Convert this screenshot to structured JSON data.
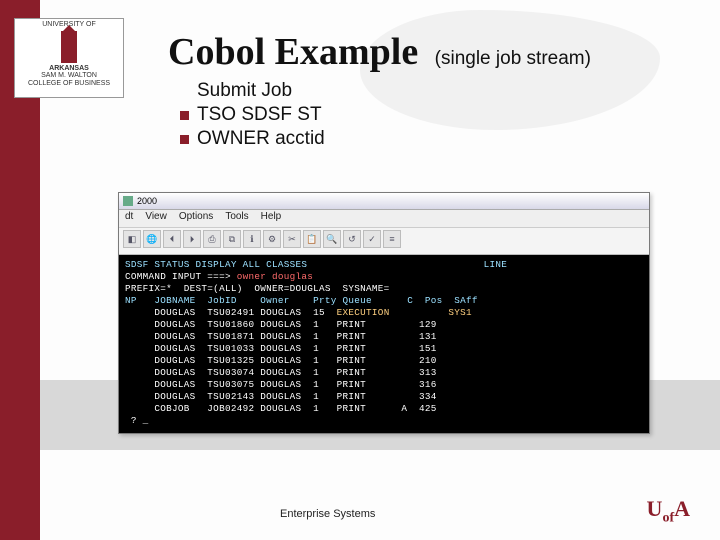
{
  "logo": {
    "line1": "UNIVERSITY OF",
    "line2": "ARKANSAS",
    "line3": "SAM M. WALTON",
    "line4": "COLLEGE OF BUSINESS"
  },
  "title": {
    "main": "Cobol Example",
    "sub": "(single job stream)"
  },
  "bullets": [
    " Submit Job",
    "TSO SDSF ST",
    "OWNER acctid"
  ],
  "terminal": {
    "window_title": "2000",
    "menubar": [
      "dt",
      "View",
      "Options",
      "Tools",
      "Help"
    ],
    "header_line": "SDSF STATUS DISPLAY ALL CLASSES                              LINE",
    "cmd_prefix": "COMMAND INPUT ===> ",
    "cmd_text": "owner douglas",
    "filter_line": "PREFIX=*  DEST=(ALL)  OWNER=DOUGLAS  SYSNAME=",
    "cols": "NP   JOBNAME  JobID    Owner    Prty Queue      C  Pos  SAff",
    "rows": [
      {
        "job": "DOUGLAS",
        "id": "TSU02491",
        "owner": "DOUGLAS",
        "prty": "15",
        "queue": "EXECUTION",
        "c": "",
        "pos": "",
        "ext": "SYS1"
      },
      {
        "job": "DOUGLAS",
        "id": "TSU01860",
        "owner": "DOUGLAS",
        "prty": "1",
        "queue": "PRINT",
        "c": "",
        "pos": "129",
        "ext": ""
      },
      {
        "job": "DOUGLAS",
        "id": "TSU01871",
        "owner": "DOUGLAS",
        "prty": "1",
        "queue": "PRINT",
        "c": "",
        "pos": "131",
        "ext": ""
      },
      {
        "job": "DOUGLAS",
        "id": "TSU01033",
        "owner": "DOUGLAS",
        "prty": "1",
        "queue": "PRINT",
        "c": "",
        "pos": "151",
        "ext": ""
      },
      {
        "job": "DOUGLAS",
        "id": "TSU01325",
        "owner": "DOUGLAS",
        "prty": "1",
        "queue": "PRINT",
        "c": "",
        "pos": "210",
        "ext": ""
      },
      {
        "job": "DOUGLAS",
        "id": "TSU03074",
        "owner": "DOUGLAS",
        "prty": "1",
        "queue": "PRINT",
        "c": "",
        "pos": "313",
        "ext": ""
      },
      {
        "job": "DOUGLAS",
        "id": "TSU03075",
        "owner": "DOUGLAS",
        "prty": "1",
        "queue": "PRINT",
        "c": "",
        "pos": "316",
        "ext": ""
      },
      {
        "job": "DOUGLAS",
        "id": "TSU02143",
        "owner": "DOUGLAS",
        "prty": "1",
        "queue": "PRINT",
        "c": "",
        "pos": "334",
        "ext": ""
      },
      {
        "job": "COBJOB ",
        "id": "JOB02492",
        "owner": "DOUGLAS",
        "prty": "1",
        "queue": "PRINT",
        "c": "A",
        "pos": "425",
        "ext": ""
      }
    ],
    "prompt": " ? _"
  },
  "footer": {
    "text": "Enterprise Systems",
    "logo": "UA"
  }
}
